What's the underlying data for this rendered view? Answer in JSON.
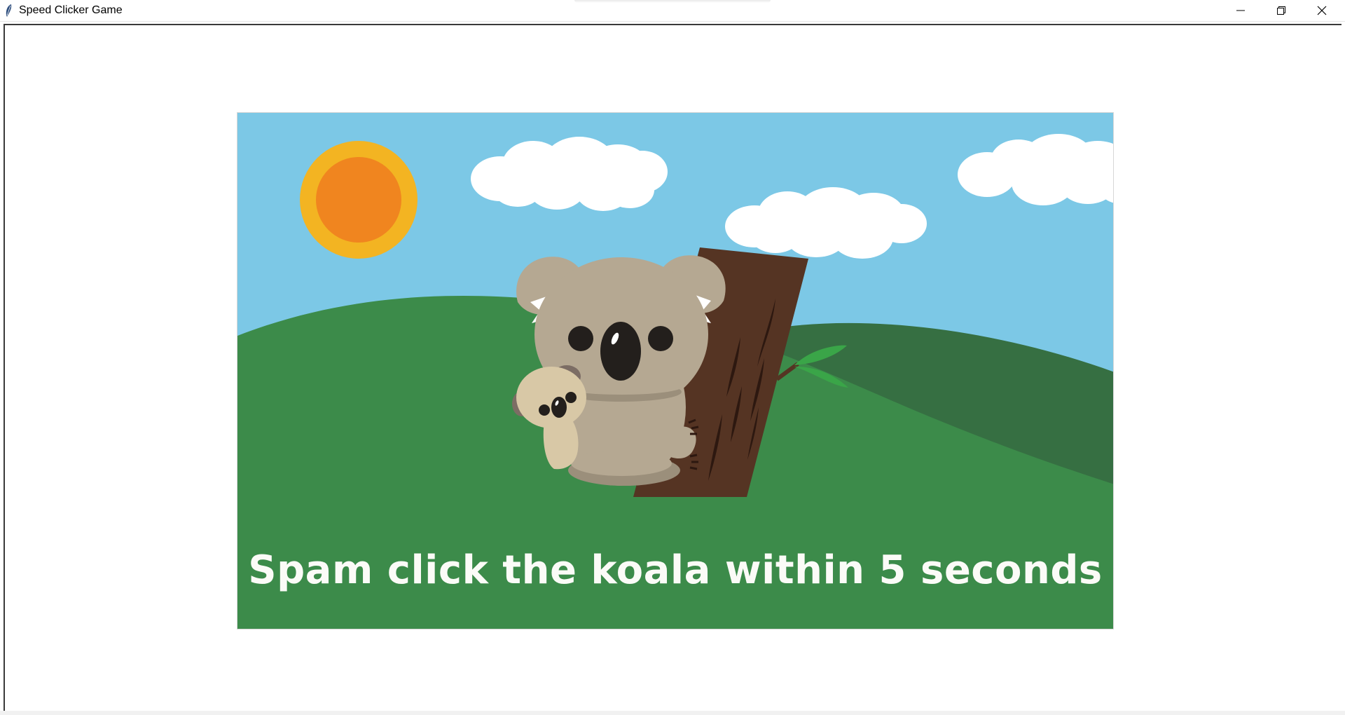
{
  "window": {
    "title": "Speed Clicker Game",
    "controls": [
      "minimize",
      "restore",
      "close"
    ]
  },
  "scene": {
    "caption": "Spam click the koala within 5 seconds",
    "colors": {
      "sky": "#7cc8e6",
      "grass": "#3c8b4a",
      "far_hill": "#366f42",
      "sun_outer": "#f3b422",
      "sun_inner": "#f0851f",
      "cloud": "#ffffff",
      "tree": "#553423",
      "koala": "#b5a892",
      "baby_koala": "#d8c8a6",
      "leaf": "#3aa548"
    },
    "icons": [
      "feather-app-icon",
      "minimize-icon",
      "restore-icon",
      "close-icon"
    ]
  }
}
